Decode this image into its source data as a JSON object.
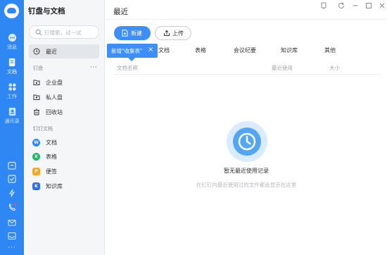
{
  "rail": {
    "items": [
      {
        "label": "消息",
        "icon": "message-icon"
      },
      {
        "label": "文档",
        "icon": "document-icon"
      },
      {
        "label": "工作",
        "icon": "work-icon"
      },
      {
        "label": "通讯录",
        "icon": "contacts-icon"
      }
    ],
    "more": "···",
    "accent": "#2f87f4"
  },
  "sidebar": {
    "title": "钉盘与文档",
    "search_placeholder": "钉搜索，试一试",
    "recent_label": "最近",
    "disk_section": "钉盘",
    "disk_more": "···",
    "disk_items": [
      {
        "label": "企业盘",
        "icon": "enterprise-disk-icon"
      },
      {
        "label": "私人盘",
        "icon": "personal-disk-icon"
      },
      {
        "label": "回收站",
        "icon": "trash-icon"
      }
    ],
    "docs_section": "钉钉文档",
    "doc_items": [
      {
        "label": "文档",
        "icon": "doc-icon",
        "color": "#2f87f4",
        "glyph": "W"
      },
      {
        "label": "表格",
        "icon": "sheet-icon",
        "color": "#21b96a",
        "glyph": "X"
      },
      {
        "label": "便签",
        "icon": "note-icon",
        "color": "#f5a623",
        "glyph": "P"
      },
      {
        "label": "知识库",
        "icon": "knowledge-base-icon",
        "color": "#2f6fe0",
        "glyph": "K"
      }
    ]
  },
  "main": {
    "title": "最近",
    "new_button": "新建",
    "upload_button": "上传",
    "tooltip": "新增\"收集表\"",
    "tooltip_close": "×",
    "tabs": [
      "文档",
      "表格",
      "会议纪要",
      "知识库",
      "其他"
    ],
    "columns": {
      "name": "文档名称",
      "recent": "最近使用",
      "size": "大小"
    },
    "empty_title": "暂无最近使用记录",
    "empty_subtitle": "在钉钉内最近使用过的文件都会显示在这里"
  }
}
